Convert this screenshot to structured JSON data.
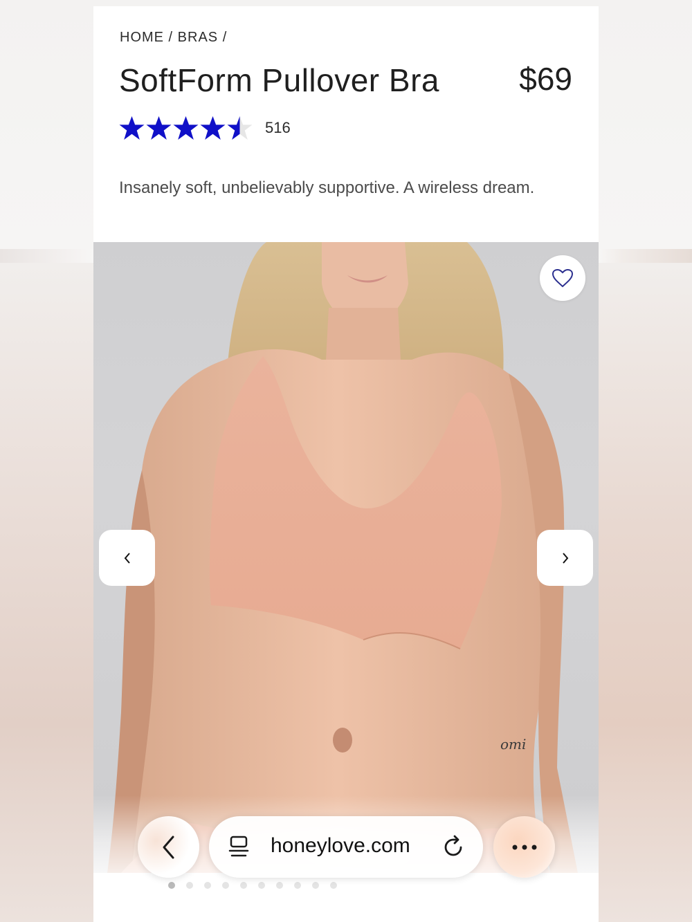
{
  "breadcrumb": "HOME / BRAS /",
  "product": {
    "title": "SoftForm Pullover Bra",
    "price": "$69",
    "rating": 4.5,
    "rating_max": 5,
    "review_count": "516",
    "description": "Insanely soft, unbelievably supportive. A wireless dream."
  },
  "gallery": {
    "image_icon": "product-photo",
    "favorite_icon": "heart-icon",
    "prev_icon": "chevron-left-icon",
    "next_icon": "chevron-right-icon",
    "slide_count": 10,
    "active_slide": 1
  },
  "browser": {
    "url": "honeylove.com",
    "back_icon": "chevron-left-icon",
    "tabs_icon": "tabs-icon",
    "reload_icon": "reload-icon",
    "more_icon": "more-icon"
  },
  "colors": {
    "star": "#1010c8",
    "star_empty": "#e6e6e6",
    "text": "#1f1f1f",
    "heart": "#2b2f8f",
    "bra": "#eab39c"
  }
}
